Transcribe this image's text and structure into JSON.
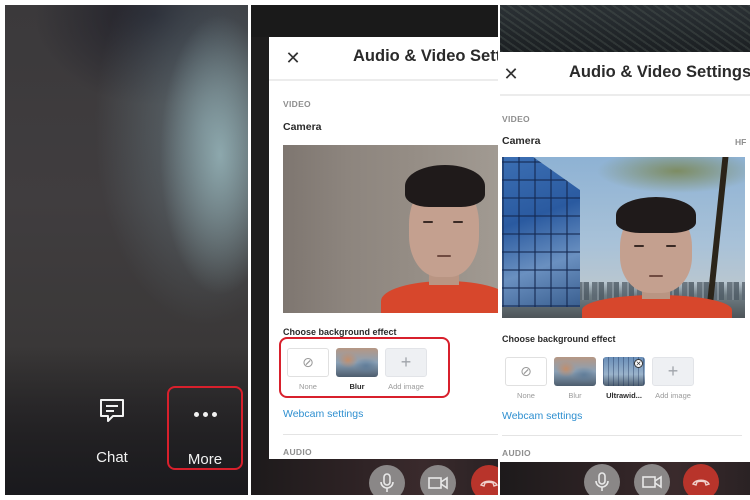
{
  "call_view": {
    "buttons": [
      {
        "id": "chat",
        "label": "Chat",
        "icon": "chat-bubble-icon"
      },
      {
        "id": "more",
        "label": "More",
        "icon": "more-dots-icon",
        "highlighted": true
      }
    ]
  },
  "settings_before": {
    "title": "Audio & Video Settings",
    "close_icon": "close-icon",
    "video_section": "VIDEO",
    "camera_label": "Camera",
    "choose_bg_label": "Choose background effect",
    "effects": [
      {
        "label": "None",
        "type": "none",
        "selected": false
      },
      {
        "label": "Blur",
        "type": "blur",
        "selected": true
      },
      {
        "label": "Add image",
        "type": "add",
        "selected": false
      }
    ],
    "webcam_link": "Webcam settings",
    "audio_section": "AUDIO"
  },
  "settings_after": {
    "title": "Audio & Video Settings",
    "close_icon": "close-icon",
    "video_section": "VIDEO",
    "camera_label": "Camera",
    "camera_value": "HF",
    "choose_bg_label": "Choose background effect",
    "effects": [
      {
        "label": "None",
        "type": "none",
        "selected": false
      },
      {
        "label": "Blur",
        "type": "blur",
        "selected": false
      },
      {
        "label": "Ultrawid...",
        "type": "ultra",
        "selected": true
      },
      {
        "label": "Add image",
        "type": "add",
        "selected": false
      }
    ],
    "webcam_link": "Webcam settings",
    "audio_section": "AUDIO"
  },
  "call_controls": [
    {
      "id": "mic",
      "icon": "microphone-icon"
    },
    {
      "id": "camera",
      "icon": "video-camera-icon"
    },
    {
      "id": "hangup",
      "icon": "hang-up-icon"
    }
  ],
  "colors": {
    "highlight": "#d8202c",
    "link": "#2e8fd0",
    "hangup": "#b8342b"
  }
}
